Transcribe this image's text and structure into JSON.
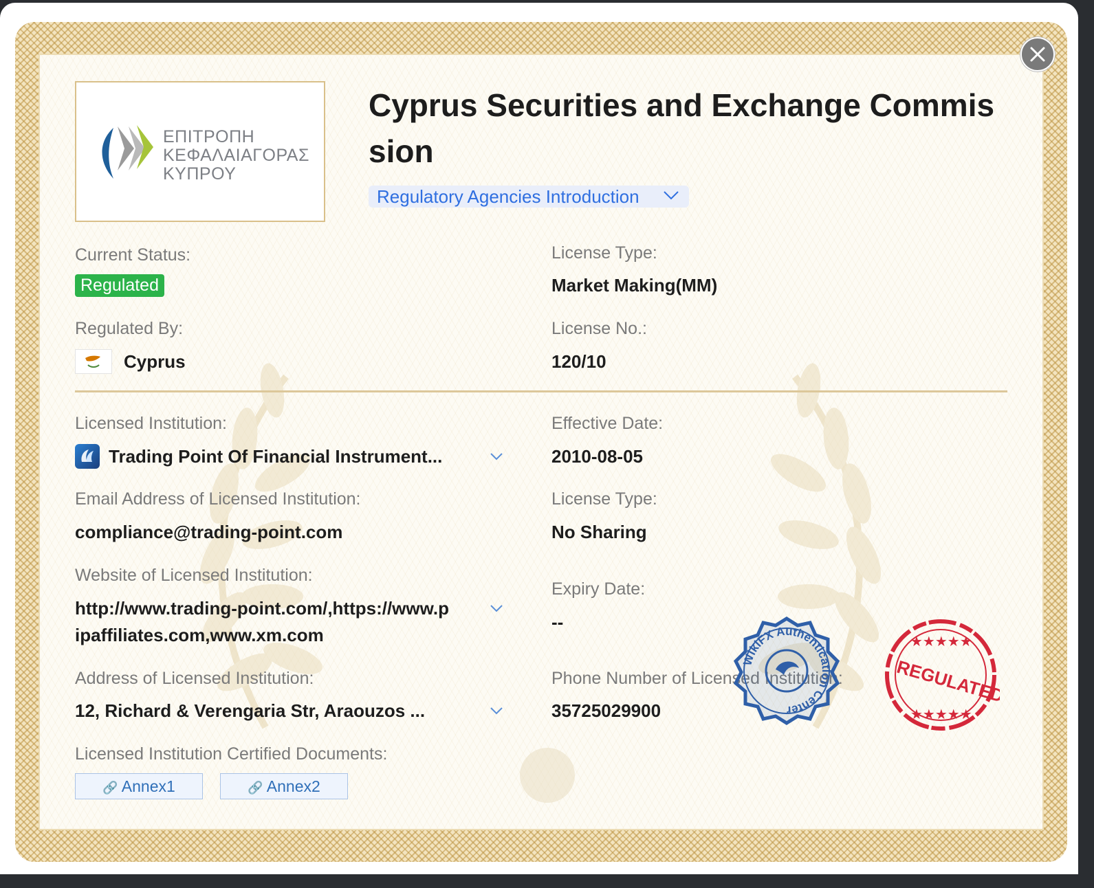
{
  "header": {
    "title": "Cyprus Securities and Exchange Commission",
    "intro_link": "Regulatory Agencies Introduction"
  },
  "logo": {
    "lines": [
      "ΕΠΙΤΡΟΠΗ",
      "ΚΕΦΑΛΑΙΑΓΟΡΑΣ",
      "ΚΥΠΡΟΥ"
    ]
  },
  "fields": {
    "current_status_label": "Current Status:",
    "current_status_value": "Regulated",
    "license_type_label": "License Type:",
    "license_type_value": "Market Making(MM)",
    "regulated_by_label": "Regulated By:",
    "regulated_by_value": "Cyprus",
    "license_no_label": "License No.:",
    "license_no_value": "120/10",
    "licensed_institution_label": "Licensed Institution:",
    "licensed_institution_value": "Trading Point Of Financial Instrument...",
    "effective_date_label": "Effective Date:",
    "effective_date_value": "2010-08-05",
    "email_label": "Email Address of Licensed Institution:",
    "email_value": "compliance@trading-point.com",
    "license_type2_label": "License Type:",
    "license_type2_value": "No Sharing",
    "website_label": "Website of Licensed Institution:",
    "website_line1": "http://www.trading-point.com/,https://www.p",
    "website_line2": "ipaffiliates.com,www.xm.com",
    "expiry_date_label": "Expiry Date:",
    "expiry_date_value": "--",
    "address_label": "Address of Licensed Institution:",
    "address_value": "12, Richard & Verengaria Str, Araouzos ...",
    "phone_label": "Phone Number of Licensed Institution:",
    "phone_value": "35725029900",
    "documents_label": "Licensed Institution Certified Documents:",
    "annex1": "Annex1",
    "annex2": "Annex2"
  },
  "stamps": {
    "wikifx_text": "WikiFX Authentication Center",
    "regulated_text": "REGULATED"
  },
  "colors": {
    "badge_green": "#2cb34a",
    "link_blue": "#2f6fe0",
    "gold_border": "#dcc79a",
    "stamp_blue": "#2f5fa8",
    "stamp_red": "#d4283a"
  }
}
